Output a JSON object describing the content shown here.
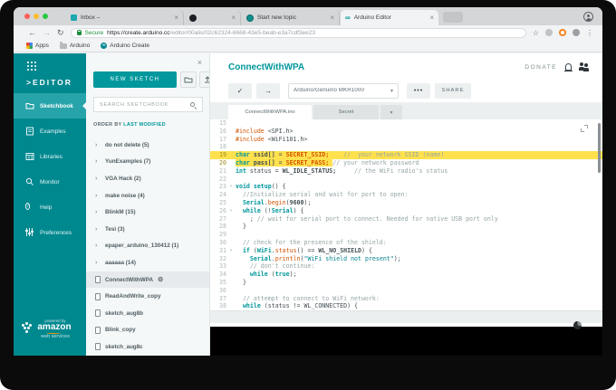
{
  "colors": {
    "accent": "#00979C",
    "sidebar": "#00888F",
    "highlight": "#FFE14D",
    "keyword": "#00979C",
    "function": "#D35400",
    "comment": "#95A5A6",
    "secure_green": "#1E8E3E"
  },
  "browser": {
    "tabs": [
      {
        "title": "Inbox –",
        "favicon": "inbox-icon",
        "active": false
      },
      {
        "title": "",
        "favicon": "github-icon",
        "active": false
      },
      {
        "title": "Start new topic",
        "favicon": "forum-icon",
        "active": false
      },
      {
        "title": "Arduino Editor",
        "favicon": "arduino-infinity-icon",
        "active": true
      }
    ],
    "close_glyph": "×",
    "back_glyph": "←",
    "forward_glyph": "→",
    "reload_glyph": "↻",
    "secure_label": "Secure",
    "url_host": "https://create.arduino.cc",
    "url_path": "/editor/00alis/02c62324-6668-43e5-beab-e3a7cdf3ee23",
    "star_glyph": "☆",
    "menu_glyph": "⋮",
    "bookmarks": [
      {
        "label": "Apps"
      },
      {
        "label": "Arduino"
      },
      {
        "label": "Arduino Create"
      }
    ]
  },
  "sidebar": {
    "logo_prefix": ">",
    "logo": "EDITOR",
    "items": [
      {
        "label": "Sketchbook",
        "icon": "folder-icon",
        "active": true
      },
      {
        "label": "Examples",
        "icon": "examples-icon",
        "active": false
      },
      {
        "label": "Libraries",
        "icon": "libraries-icon",
        "active": false
      },
      {
        "label": "Monitor",
        "icon": "monitor-icon",
        "active": false
      },
      {
        "label": "Help",
        "icon": "help-icon",
        "active": false
      },
      {
        "label": "Preferences",
        "icon": "preferences-icon",
        "active": false
      }
    ],
    "aws": {
      "powered_by": "powered by",
      "name": "amazon",
      "sub": "web services"
    }
  },
  "sketchbook": {
    "close_glyph": "×",
    "new_sketch_label": "NEW SKETCH",
    "search_placeholder": "SEARCH SKETCHBOOK",
    "order_by_label": "ORDER BY",
    "order_by_value": "LAST MODIFIED",
    "items": [
      {
        "label": "do not delete (5)",
        "type": "folder"
      },
      {
        "label": "YunExamples (7)",
        "type": "folder"
      },
      {
        "label": "VGA Hack (2)",
        "type": "folder"
      },
      {
        "label": "make noise (4)",
        "type": "folder"
      },
      {
        "label": "BlinkM (15)",
        "type": "folder"
      },
      {
        "label": "Tesi (3)",
        "type": "folder"
      },
      {
        "label": "epaper_arduino_130412 (1)",
        "type": "folder"
      },
      {
        "label": "aaaaaa (14)",
        "type": "folder"
      },
      {
        "label": "ConnectWithWPA",
        "type": "sketch",
        "selected": true,
        "gear": true
      },
      {
        "label": "ReadAndWrite_copy",
        "type": "sketch"
      },
      {
        "label": "sketch_aug8b",
        "type": "sketch"
      },
      {
        "label": "Blink_copy",
        "type": "sketch"
      },
      {
        "label": "sketch_aug8c",
        "type": "sketch"
      }
    ]
  },
  "editor": {
    "title": "ConnectWithWPA",
    "donate_label": "DONATE",
    "verify_glyph": "✓",
    "upload_glyph": "→",
    "board_selector": "Arduino/Genuino MKR1000",
    "board_caret": "▾",
    "more_label": "•••",
    "share_label": "SHARE",
    "tabs": [
      {
        "label": "ConnectWithWPA.ino",
        "active": true
      },
      {
        "label": "Secret",
        "active": false
      }
    ],
    "tab_caret": "▾",
    "code": {
      "lines": [
        {
          "n": 15,
          "segs": []
        },
        {
          "n": 16,
          "segs": [
            [
              "f",
              "#include"
            ],
            [
              "p",
              " <SPI.h>"
            ]
          ]
        },
        {
          "n": 17,
          "segs": [
            [
              "f",
              "#include"
            ],
            [
              "p",
              " <WiFi101.h>"
            ]
          ]
        },
        {
          "n": 18,
          "segs": []
        },
        {
          "n": 19,
          "hl": "full",
          "segs": [
            [
              "k",
              "char"
            ],
            [
              "b",
              " ssid[]"
            ],
            [
              "p",
              " = "
            ],
            [
              "c",
              "SECRET_SSID;"
            ],
            [
              "p",
              "    "
            ],
            [
              "m",
              "//  your network SSID (name)"
            ]
          ]
        },
        {
          "n": 20,
          "hl": 5,
          "segs": [
            [
              "k",
              "char"
            ],
            [
              "b",
              " pass[]"
            ],
            [
              "p",
              " = "
            ],
            [
              "c",
              "SECRET_PASS;"
            ],
            [
              "p",
              " "
            ],
            [
              "m",
              "// your network password"
            ]
          ]
        },
        {
          "n": 21,
          "segs": [
            [
              "k",
              "int"
            ],
            [
              "p",
              " status = "
            ],
            [
              "b",
              "WL_IDLE_STATUS;"
            ],
            [
              "p",
              "     "
            ],
            [
              "m",
              "// the WiFi radio's status"
            ]
          ]
        },
        {
          "n": 22,
          "segs": []
        },
        {
          "n": 23,
          "fold": true,
          "segs": [
            [
              "k",
              "void setup"
            ],
            [
              "p",
              "() {"
            ]
          ]
        },
        {
          "n": 24,
          "segs": [
            [
              "p",
              "  "
            ],
            [
              "m",
              "//Initialize serial and wait for port to open:"
            ]
          ]
        },
        {
          "n": 25,
          "segs": [
            [
              "p",
              "  "
            ],
            [
              "k",
              "Serial"
            ],
            [
              "p",
              "."
            ],
            [
              "f",
              "begin"
            ],
            [
              "p",
              "("
            ],
            [
              "b",
              "9600"
            ],
            [
              "p",
              ");"
            ]
          ]
        },
        {
          "n": 26,
          "fold": true,
          "segs": [
            [
              "p",
              "  "
            ],
            [
              "k",
              "while"
            ],
            [
              "p",
              " (!"
            ],
            [
              "k",
              "Serial"
            ],
            [
              "p",
              ") {"
            ]
          ]
        },
        {
          "n": 27,
          "segs": [
            [
              "p",
              "    ; "
            ],
            [
              "m",
              "// wait for serial port to connect. Needed for native USB port only"
            ]
          ]
        },
        {
          "n": 28,
          "segs": [
            [
              "p",
              "  }"
            ]
          ]
        },
        {
          "n": 29,
          "segs": []
        },
        {
          "n": 30,
          "segs": [
            [
              "p",
              "  "
            ],
            [
              "m",
              "// check for the presence of the shield:"
            ]
          ]
        },
        {
          "n": 31,
          "fold": true,
          "segs": [
            [
              "p",
              "  "
            ],
            [
              "k",
              "if"
            ],
            [
              "p",
              " ("
            ],
            [
              "k",
              "WiFi"
            ],
            [
              "p",
              "."
            ],
            [
              "f",
              "status"
            ],
            [
              "p",
              "() == "
            ],
            [
              "b",
              "WL_NO_SHIELD"
            ],
            [
              "p",
              ") {"
            ]
          ]
        },
        {
          "n": 32,
          "segs": [
            [
              "p",
              "    "
            ],
            [
              "k",
              "Serial"
            ],
            [
              "p",
              "."
            ],
            [
              "f",
              "println"
            ],
            [
              "p",
              "("
            ],
            [
              "s",
              "\"WiFi shield not present\""
            ],
            [
              "p",
              ");"
            ]
          ]
        },
        {
          "n": 33,
          "segs": [
            [
              "p",
              "    "
            ],
            [
              "m",
              "// don't continue:"
            ]
          ]
        },
        {
          "n": 34,
          "segs": [
            [
              "p",
              "    "
            ],
            [
              "k",
              "while"
            ],
            [
              "p",
              " ("
            ],
            [
              "k",
              "true"
            ],
            [
              "p",
              ");"
            ]
          ]
        },
        {
          "n": 35,
          "segs": [
            [
              "p",
              "  }"
            ]
          ]
        },
        {
          "n": 36,
          "segs": []
        },
        {
          "n": 37,
          "segs": [
            [
              "p",
              "  "
            ],
            [
              "m",
              "// attempt to connect to WiFi network:"
            ]
          ]
        },
        {
          "n": 38,
          "segs": [
            [
              "p",
              "  "
            ],
            [
              "k",
              "while"
            ],
            [
              "p",
              " (status != WL_CONNECTED) {"
            ]
          ]
        }
      ]
    }
  }
}
